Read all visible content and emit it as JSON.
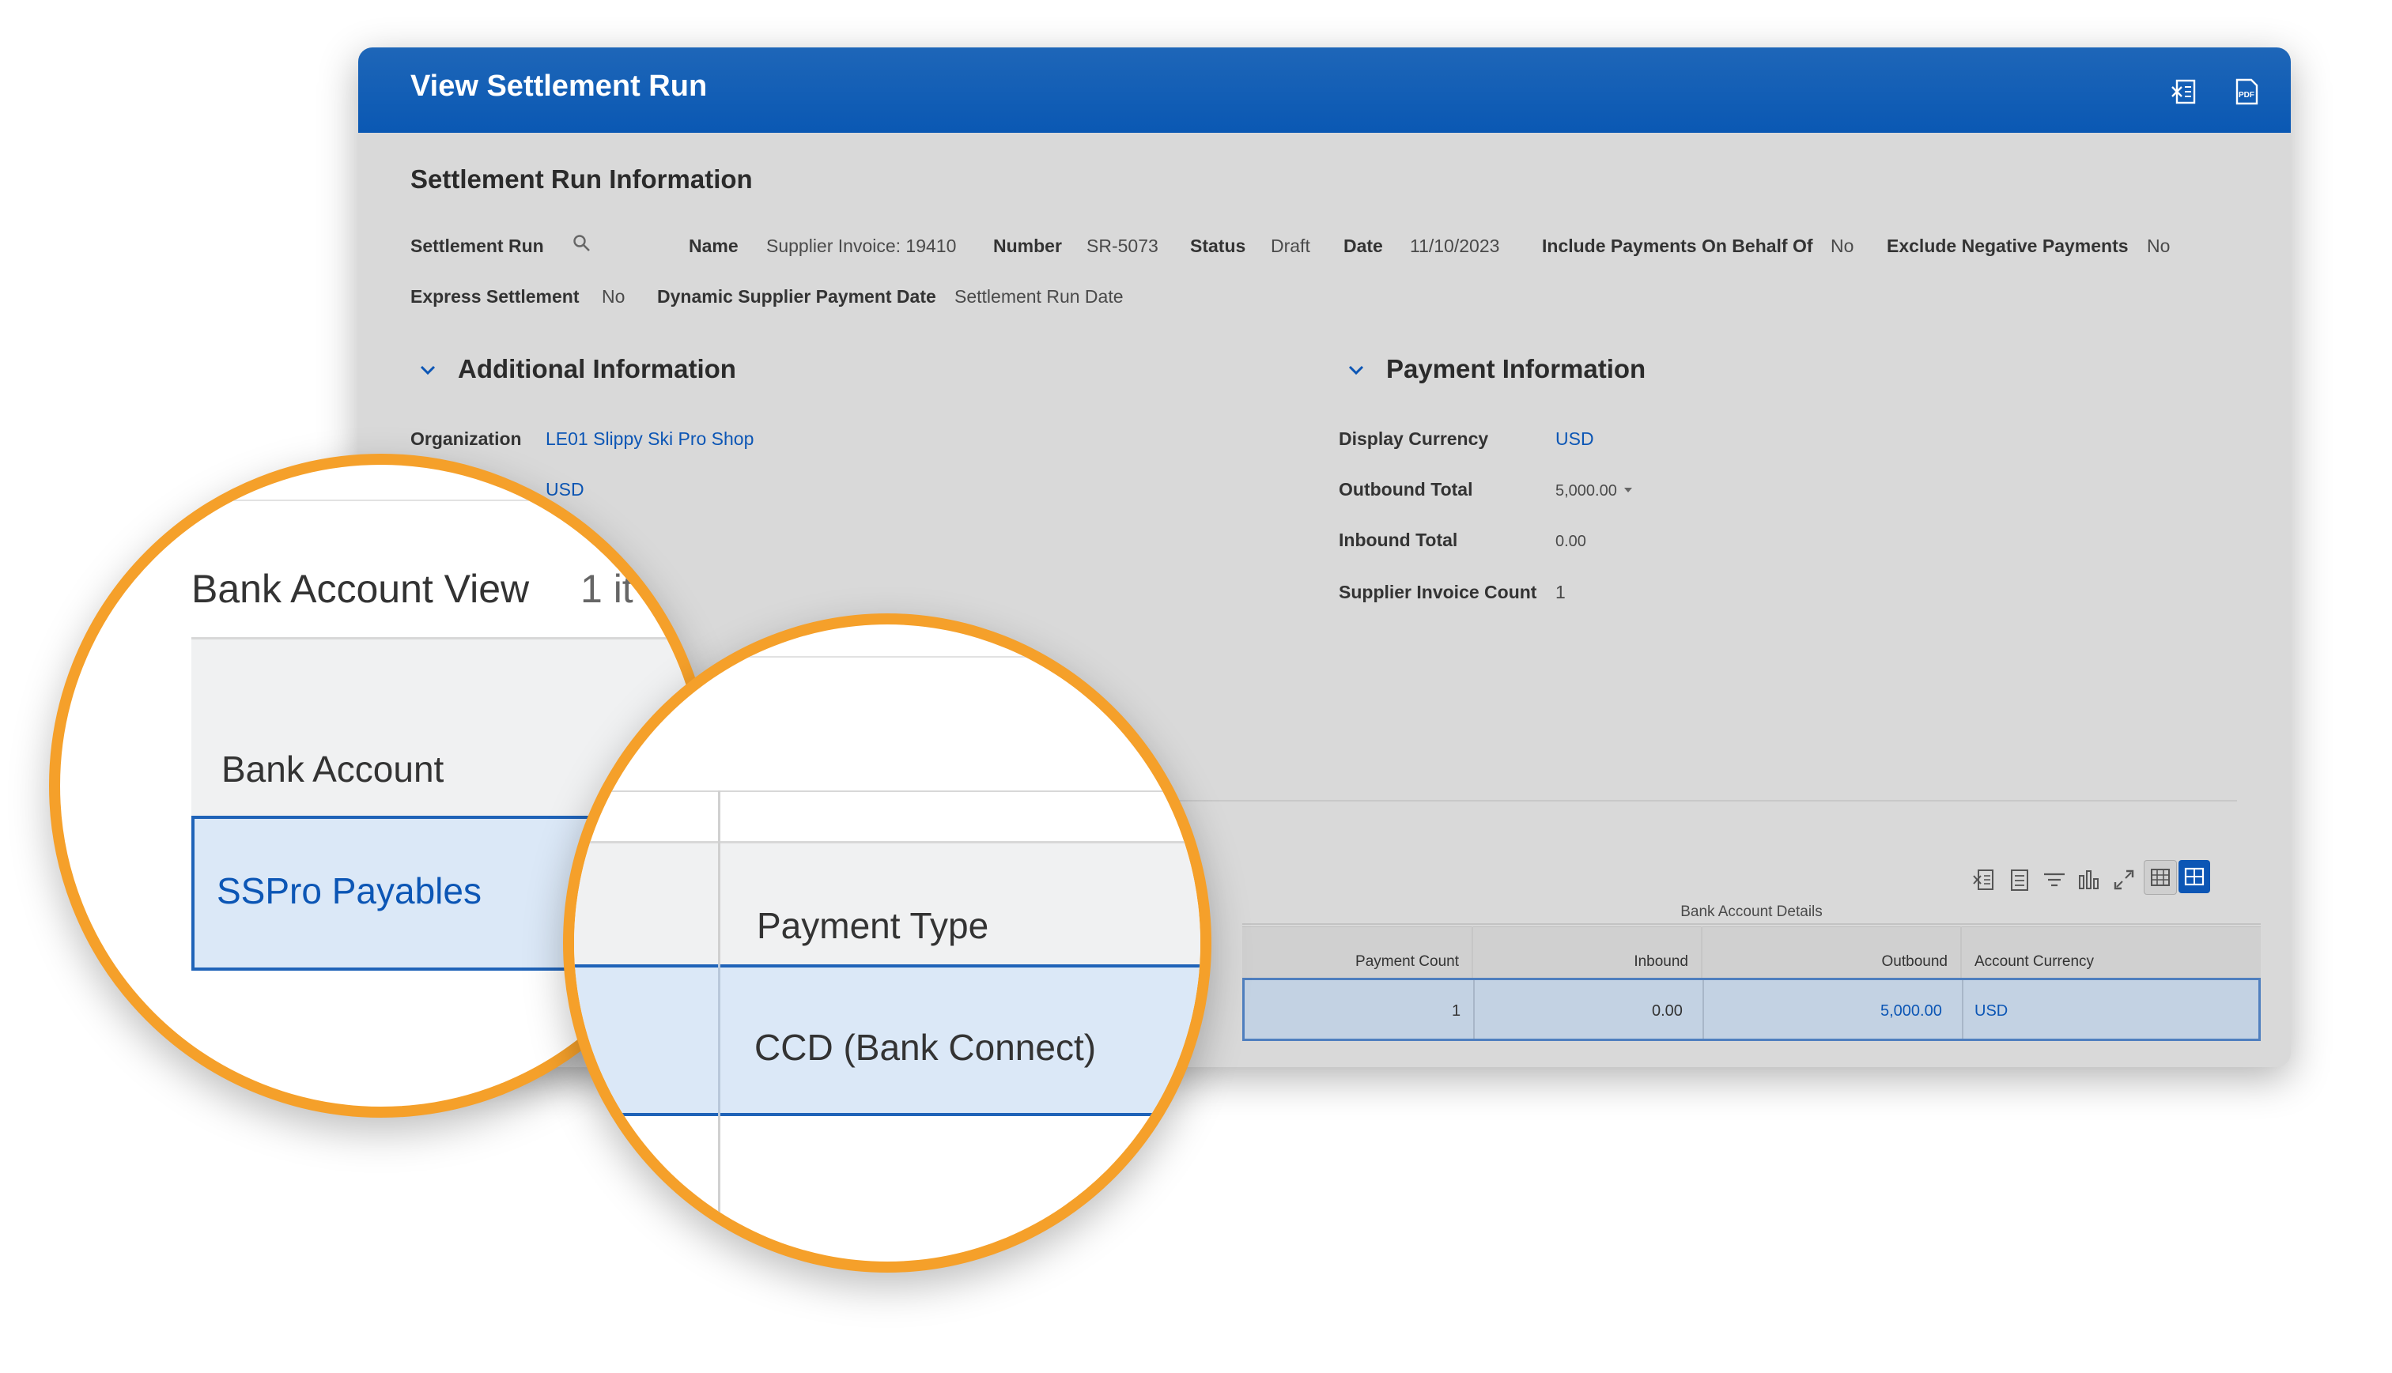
{
  "window": {
    "title": "View Settlement Run",
    "icons": [
      "export-excel-icon",
      "export-pdf-icon"
    ]
  },
  "info": {
    "section_title": "Settlement Run Information",
    "settlement_run_label": "Settlement Run",
    "name_label": "Name",
    "name_value": "Supplier Invoice: 19410",
    "number_label": "Number",
    "number_value": "SR-5073",
    "status_label": "Status",
    "status_value": "Draft",
    "date_label": "Date",
    "date_value": "11/10/2023",
    "include_label": "Include Payments On Behalf Of",
    "include_value": "No",
    "exclude_label": "Exclude Negative Payments",
    "exclude_value": "No",
    "express_label": "Express Settlement",
    "express_value": "No",
    "dynamic_label": "Dynamic Supplier Payment Date",
    "dynamic_value": "Settlement Run Date"
  },
  "additional": {
    "title": "Additional Information",
    "org_label": "Organization",
    "org_value": "LE01 Slippy Ski Pro Shop",
    "currency_value": "USD"
  },
  "payment": {
    "title": "Payment Information",
    "display_currency_label": "Display Currency",
    "display_currency_value": "USD",
    "outbound_total_label": "Outbound Total",
    "outbound_total_value": "5,000.00",
    "inbound_total_label": "Inbound Total",
    "inbound_total_value": "0.00",
    "invoice_count_label": "Supplier Invoice Count",
    "invoice_count_value": "1"
  },
  "table": {
    "group_header": "Bank Account Details",
    "columns": [
      "Payment Count",
      "Inbound",
      "Outbound",
      "Account Currency"
    ],
    "row": [
      "1",
      "0.00",
      "5,000.00",
      "USD"
    ]
  },
  "magnifier_one": {
    "view_title": "Bank Account View",
    "item_count": "1 it",
    "column_header": "Bank Account",
    "cell_value": "SSPro Payables"
  },
  "magnifier_two": {
    "column_header": "Payment Type",
    "cell_value": "CCD (Bank Connect)"
  },
  "colors": {
    "titlebar": "#0a58b3",
    "link": "#0c56b5",
    "highlight_border": "#f5a02a",
    "selected_row": "#c3d2e3"
  }
}
